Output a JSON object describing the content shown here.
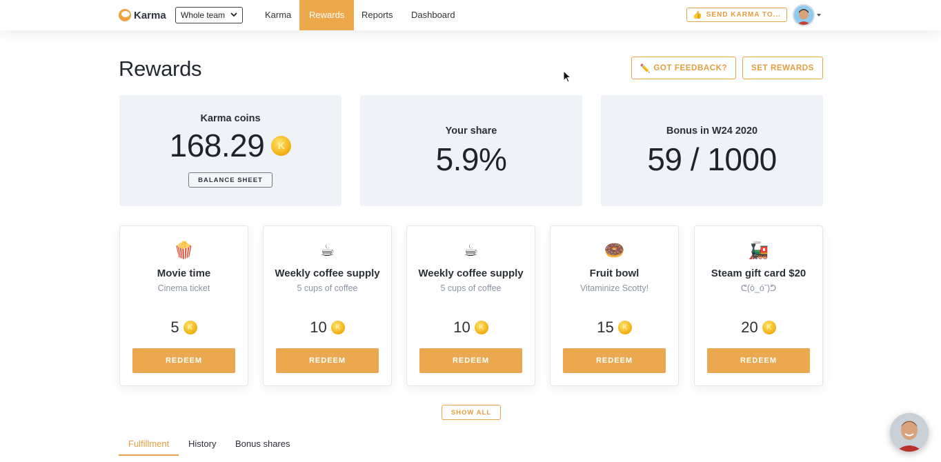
{
  "nav": {
    "logo_text": "Karma",
    "team_select": "Whole team",
    "links": [
      "Karma",
      "Rewards",
      "Reports",
      "Dashboard"
    ],
    "active_link": "Rewards",
    "send_button": "SEND KARMA TO...",
    "accent_color": "#eea84c"
  },
  "page": {
    "title": "Rewards",
    "feedback_button": "GOT FEEDBACK?",
    "set_rewards_button": "SET REWARDS"
  },
  "stats": {
    "coins_label": "Karma coins",
    "coins_value": "168.29",
    "balance_button": "BALANCE SHEET",
    "share_label": "Your share",
    "share_value": "5.9%",
    "bonus_label": "Bonus in W24 2020",
    "bonus_value": "59 / 1000"
  },
  "rewards": [
    {
      "icon": "popcorn-icon",
      "glyph": "🍿",
      "title": "Movie time",
      "desc": "Cinema ticket",
      "price": "5",
      "button": "REDEEM"
    },
    {
      "icon": "coffee-icon",
      "glyph": "☕",
      "title": "Weekly coffee supply",
      "desc": "5 cups of coffee",
      "price": "10",
      "button": "REDEEM"
    },
    {
      "icon": "coffee-icon",
      "glyph": "☕",
      "title": "Weekly coffee supply",
      "desc": "5 cups of coffee",
      "price": "10",
      "button": "REDEEM"
    },
    {
      "icon": "fruit-bowl-icon",
      "glyph": "🍩",
      "title": "Fruit bowl",
      "desc": "Vitaminize Scotty!",
      "price": "15",
      "button": "REDEEM"
    },
    {
      "icon": "train-icon",
      "glyph": "🚂",
      "title": "Steam gift card $20",
      "desc": "ᕦ(ò_óˇ)ᕤ",
      "price": "20",
      "button": "REDEEM"
    }
  ],
  "show_all": "SHOW ALL",
  "tabs": [
    "Fulfillment",
    "History",
    "Bonus shares"
  ],
  "active_tab": "Fulfillment"
}
